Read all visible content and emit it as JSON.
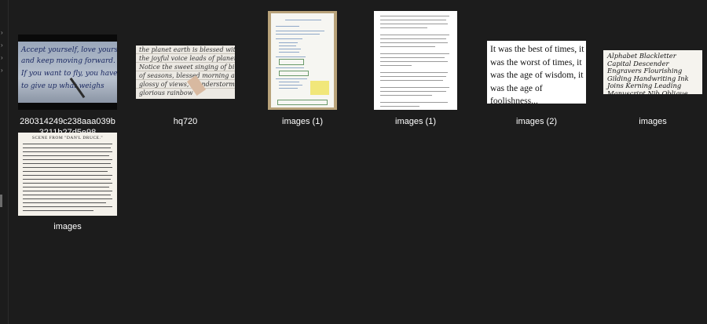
{
  "files": [
    {
      "name": "280314249c238aaa039b3211b27d5e98",
      "kind": "handwriting-video-frame",
      "text_lines": [
        "Accept yourself, love yourself,",
        "and keep moving forward.",
        "If you want to fly, you have",
        "to give up what weighs"
      ]
    },
    {
      "name": "hq720",
      "kind": "handwriting-paper-photo",
      "text_lines": [
        "the planet earth is blessed with life",
        "the joyful voice leads of planet earth",
        "Notice the sweet singing of birds, change",
        "of seasons, blessed morning and evenings",
        "glossy of views, thunderstorm, rains,",
        "glorious rainbow"
      ]
    },
    {
      "name": "images (1)",
      "kind": "notebook-page"
    },
    {
      "name": "images (1)",
      "kind": "document-page"
    },
    {
      "name": "images (2)",
      "kind": "quote-image",
      "quote": "It was the best of times, it was the worst of times, it was the age of wisdom, it was the age of foolishness..."
    },
    {
      "name": "images",
      "kind": "calligraphy-sample",
      "text": "Alphabet Blackletter Capital Descender Engravers Flourishing Gilding Handwriting Ink Joins Kerning Leading Manuscript Nib Oblique Parchment Quarto Ruler Spacing Thymol Uncial Vellum Water Xheight York Yo Zed"
    },
    {
      "name": "images",
      "kind": "newspaper-clipping",
      "headline": "SCENE FROM \"DAN'L DRUCE.\""
    }
  ]
}
